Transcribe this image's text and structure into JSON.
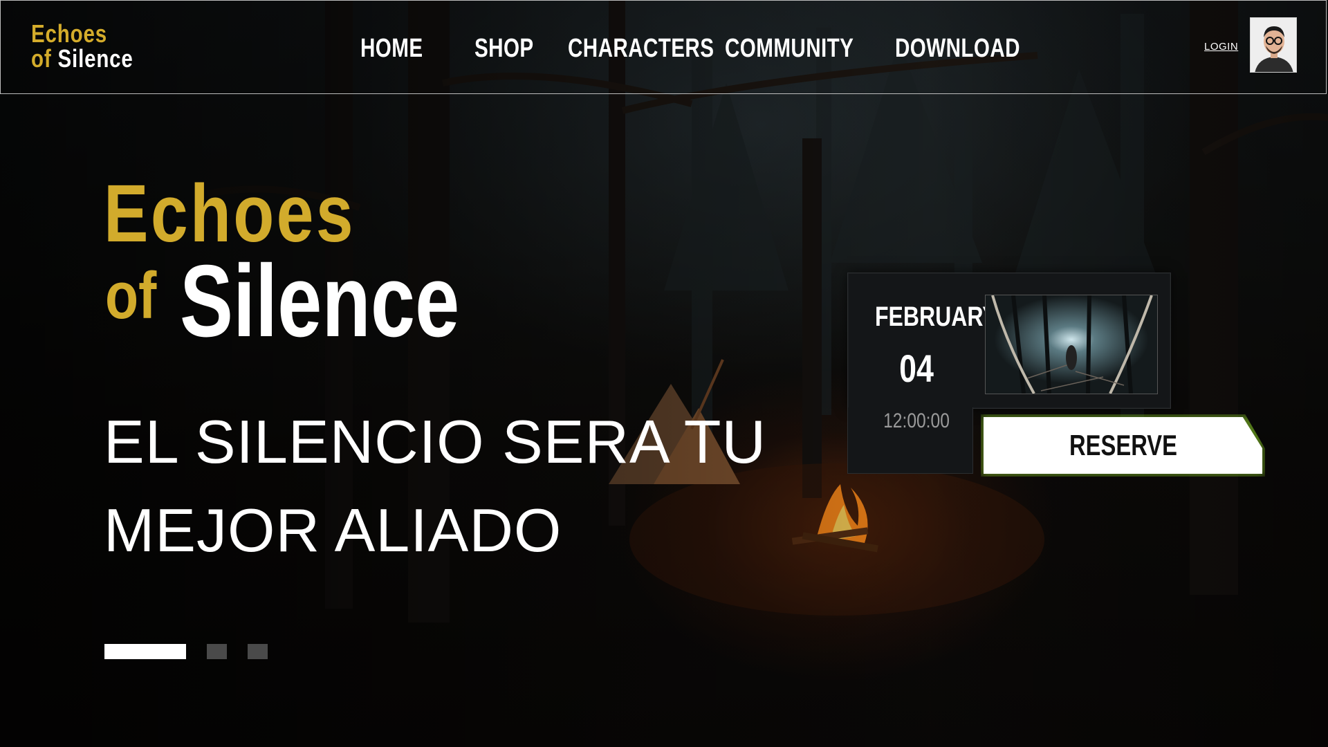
{
  "brand": {
    "line1": "Echoes",
    "line2_prefix": "of",
    "line2_main": "Silence"
  },
  "nav": {
    "items": [
      "HOME",
      "SHOP",
      "CHARACTERS",
      "COMMUNITY",
      "DOWNLOAD"
    ],
    "login": "LOGIN"
  },
  "hero": {
    "title_word1": "Echoes",
    "title_word2": "of",
    "title_word3": "Silence",
    "tagline_line1": "EL SILENCIO SERA TU",
    "tagline_line2": "MEJOR ALIADO"
  },
  "event": {
    "month": "FEBRUARY",
    "day": "04",
    "time": "12:00:00",
    "button": "RESERVE"
  },
  "carousel": {
    "slide_count": 3,
    "active_index": 0
  },
  "colors": {
    "brand_yellow": "#d4ac2b",
    "glow_green": "#8cd228",
    "background": "#0b0a09"
  },
  "icons": {
    "avatar": "user-avatar-photo",
    "thumbnail": "dark-forest-flashlight-image",
    "background": "campfire-forest-night-image"
  }
}
